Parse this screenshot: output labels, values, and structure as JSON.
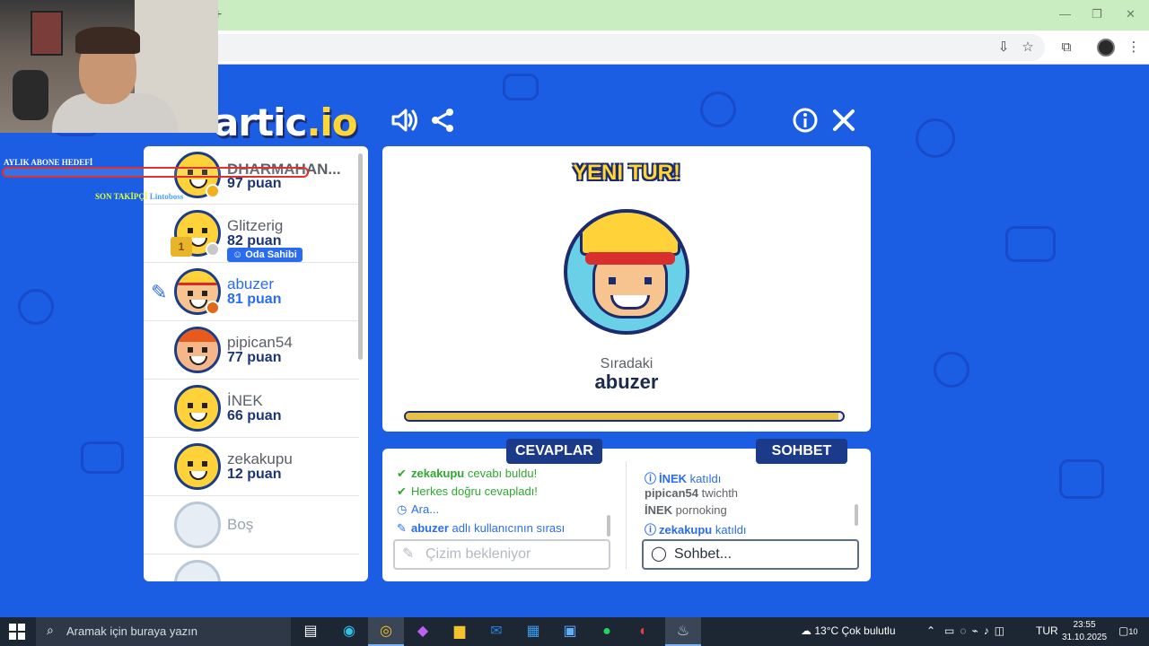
{
  "browser": {
    "new_tab_symbol": "+",
    "window_controls": [
      "—",
      "❐",
      "✕"
    ],
    "toolbar_icons": [
      "install-icon",
      "star-icon",
      "extensions-icon",
      "profile-icon",
      "menu-icon"
    ]
  },
  "game": {
    "logo_main": "artic",
    "logo_highlight": ".io",
    "header_icons": [
      "sound-icon",
      "share-icon",
      "info-icon",
      "close-icon"
    ],
    "players": [
      {
        "name": "DHARMAHAN...",
        "points": "97 puan",
        "dot_color": "#f2b01e",
        "type": "default"
      },
      {
        "name": "Glitzerig",
        "points": "82 puan",
        "dot_color": "#c8c8c8",
        "type": "default",
        "owner_tag": "Oda Sahibi",
        "trophy": "1"
      },
      {
        "name": "abuzer",
        "points": "81 puan",
        "dot_color": "#e06a1c",
        "type": "boy",
        "current": true
      },
      {
        "name": "pipican54",
        "points": "77 puan",
        "dot_color": "",
        "type": "red"
      },
      {
        "name": "İNEK",
        "points": "66 puan",
        "dot_color": "",
        "type": "default"
      },
      {
        "name": "zekakupu",
        "points": "12 puan",
        "dot_color": "",
        "type": "default"
      },
      {
        "name": "Boş",
        "points": "",
        "dot_color": "",
        "type": "empty"
      }
    ],
    "card": {
      "title": "YENI TUR!",
      "next_label": "Sıradaki",
      "next_name": "abuzer",
      "progress_fraction": 0.99
    },
    "answers": {
      "label": "CEVAPLAR",
      "messages": [
        {
          "icon": "✔",
          "bold": "zekakupu",
          "text": " cevabı buldu!",
          "color": "green"
        },
        {
          "icon": "✔",
          "bold": "",
          "text": "Herkes doğru cevapladı!",
          "color": "green"
        },
        {
          "icon": "◷",
          "bold": "",
          "text": "Ara...",
          "color": "blue"
        },
        {
          "icon": "✎",
          "bold": "abuzer",
          "text": " adlı kullanıcının sırası",
          "color": "blue"
        }
      ],
      "input_placeholder": "Çizim bekleniyor"
    },
    "chat": {
      "label": "SOHBET",
      "messages": [
        {
          "icon": "ⓘ",
          "bold": "İNEK",
          "text": " katıldı",
          "color": "blue"
        },
        {
          "icon": "",
          "bold": "pipican54",
          "text": " twichth",
          "color": "grey"
        },
        {
          "icon": "",
          "bold": "İNEK",
          "text": " pornoking",
          "color": "grey"
        },
        {
          "icon": "ⓘ",
          "bold": "zekakupu",
          "text": " katıldı",
          "color": "blue"
        }
      ],
      "input_placeholder": "Sohbet..."
    }
  },
  "overlay": {
    "goal_label": "AYLIK ABONE HEDEFİ",
    "follower_label": "SON TAKİPÇİ",
    "follower_name": "Lintoboss"
  },
  "taskbar": {
    "search_placeholder": "Aramak için buraya yazın",
    "weather": "13°C  Çok bulutlu",
    "language": "TUR",
    "time": "23:55",
    "date": "31.10.2025",
    "notification_count": "10"
  }
}
